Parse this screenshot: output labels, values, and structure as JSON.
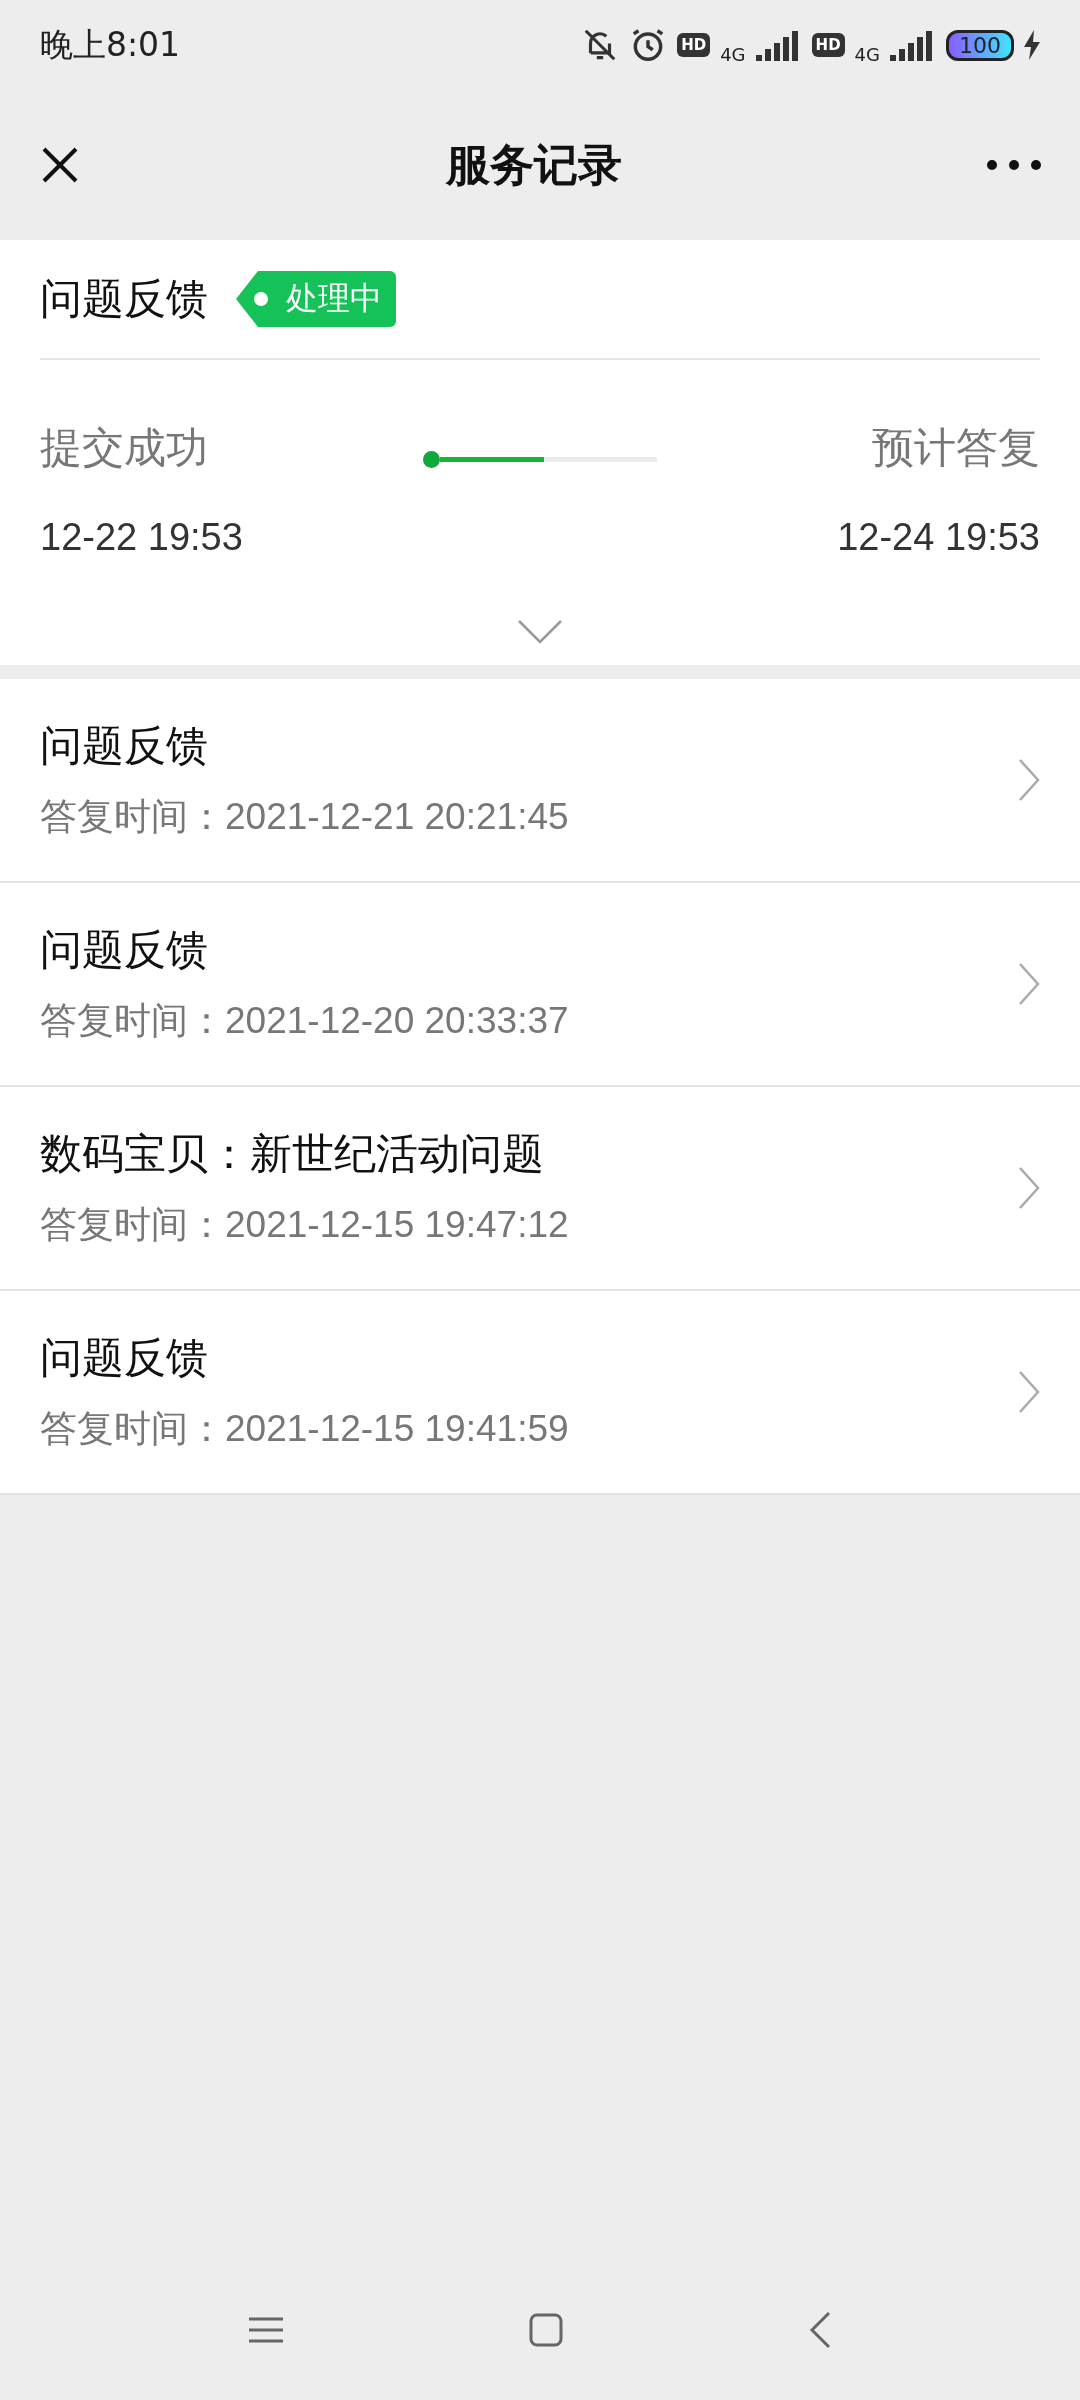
{
  "status_bar": {
    "time": "晚上8:01",
    "sims": [
      {
        "hd": "HD",
        "network": "4G"
      },
      {
        "hd": "HD",
        "network": "4G"
      }
    ],
    "battery": "100",
    "charging": true
  },
  "nav": {
    "title": "服务记录"
  },
  "ticket": {
    "title": "问题反馈",
    "status": "处理中",
    "start_label": "提交成功",
    "start_time": "12-22 19:53",
    "end_label": "预计答复",
    "end_time": "12-24 19:53",
    "level": 0.48,
    "expanded": false
  },
  "records": [
    {
      "title": "问题反馈",
      "reply_time": "答复时间：2021-12-21 20:21:45"
    },
    {
      "title": "问题反馈",
      "reply_time": "答复时间：2021-12-20 20:33:37"
    },
    {
      "title": "数码宝贝：新世纪活动问题",
      "reply_time": "答复时间：2021-12-15 19:47:12"
    },
    {
      "title": "问题反馈",
      "reply_time": "答复时间：2021-12-15 19:41:59"
    }
  ]
}
